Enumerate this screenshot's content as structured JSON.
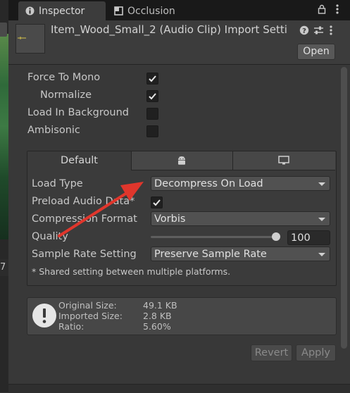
{
  "tabs": {
    "inspector": "Inspector",
    "occlusion": "Occlusion"
  },
  "scene": {
    "number": "7"
  },
  "header": {
    "title": "Item_Wood_Small_2 (Audio Clip) Import Setti",
    "open_label": "Open"
  },
  "props": {
    "force_mono": "Force To Mono",
    "normalize": "Normalize",
    "load_bg": "Load In Background",
    "ambisonic": "Ambisonic"
  },
  "checked": {
    "force_mono": true,
    "normalize": true,
    "load_bg": false,
    "ambisonic": false,
    "preload": true
  },
  "platform_tabs": {
    "default": "Default"
  },
  "platform": {
    "load_type_label": "Load Type",
    "load_type_value": "Decompress On Load",
    "preload_label": "Preload Audio Data*",
    "compression_label": "Compression Format",
    "compression_value": "Vorbis",
    "quality_label": "Quality",
    "quality_value": "100",
    "quality_level": 1.0,
    "sample_rate_label": "Sample Rate Setting",
    "sample_rate_value": "Preserve Sample Rate",
    "note": "* Shared setting between multiple platforms."
  },
  "info": {
    "original_label": "Original Size:",
    "original_value": "49.1 KB",
    "imported_label": "Imported Size:",
    "imported_value": "2.8 KB",
    "ratio_label": "Ratio:",
    "ratio_value": "5.60%"
  },
  "buttons": {
    "revert": "Revert",
    "apply": "Apply"
  },
  "colors": {
    "background": "#383838",
    "arrow": "#e0362c"
  }
}
